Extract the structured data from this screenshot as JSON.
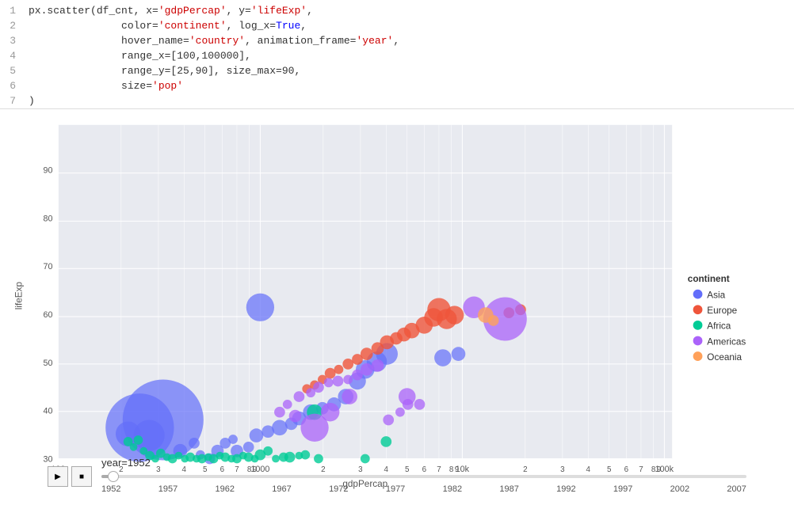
{
  "code": {
    "lines": [
      {
        "num": 1,
        "content": [
          {
            "text": "px.scatter(df_cnt, x=",
            "type": "normal"
          },
          {
            "text": "'gdpPercap'",
            "type": "str"
          },
          {
            "text": ", y=",
            "type": "normal"
          },
          {
            "text": "'lifeExp'",
            "type": "str"
          },
          {
            "text": ",",
            "type": "normal"
          }
        ]
      },
      {
        "num": 2,
        "content": [
          {
            "text": "               color=",
            "type": "normal"
          },
          {
            "text": "'continent'",
            "type": "str"
          },
          {
            "text": ", log_x=",
            "type": "normal"
          },
          {
            "text": "True",
            "type": "kw"
          },
          {
            "text": ",",
            "type": "normal"
          }
        ]
      },
      {
        "num": 3,
        "content": [
          {
            "text": "               hover_name=",
            "type": "normal"
          },
          {
            "text": "'country'",
            "type": "str"
          },
          {
            "text": ", animation_frame=",
            "type": "normal"
          },
          {
            "text": "'year'",
            "type": "str"
          },
          {
            "text": ",",
            "type": "normal"
          }
        ]
      },
      {
        "num": 4,
        "content": [
          {
            "text": "               range_x=[100,100000],",
            "type": "normal"
          }
        ]
      },
      {
        "num": 5,
        "content": [
          {
            "text": "               range_y=[25,90], size_max=90,",
            "type": "normal"
          }
        ]
      },
      {
        "num": 6,
        "content": [
          {
            "text": "               size=",
            "type": "normal"
          },
          {
            "text": "'pop'",
            "type": "str"
          },
          {
            "text": "",
            "type": "normal"
          }
        ]
      },
      {
        "num": 7,
        "content": [
          {
            "text": ")",
            "type": "normal"
          }
        ]
      }
    ]
  },
  "chart": {
    "title": "",
    "xAxis": "gdpPercap",
    "yAxis": "lifeExp",
    "yAxisLabel": "lifeExp",
    "xLabel": "gdpPercap",
    "yMin": 25,
    "yMax": 90,
    "legend": {
      "title": "continent",
      "items": [
        {
          "label": "Asia",
          "color": "#636EFA"
        },
        {
          "label": "Europe",
          "color": "#EF553B"
        },
        {
          "label": "Africa",
          "color": "#00CC96"
        },
        {
          "label": "Americas",
          "color": "#AB63FA"
        },
        {
          "label": "Oceania",
          "color": "#FFA15A"
        }
      ]
    },
    "yTicks": [
      30,
      40,
      50,
      60,
      70,
      80,
      90
    ],
    "xTickGroups": [
      {
        "label": "100",
        "ticks": []
      },
      {
        "label": "",
        "subTicks": [
          "2",
          "3",
          "4",
          "5",
          "6",
          "7",
          "8",
          "9"
        ]
      },
      {
        "label": "1000",
        "ticks": []
      },
      {
        "label": "",
        "subTicks": [
          "2",
          "3",
          "4",
          "5",
          "6",
          "7",
          "8",
          "9"
        ]
      },
      {
        "label": "10k",
        "ticks": []
      },
      {
        "label": "",
        "subTicks": [
          "2",
          "3",
          "4",
          "5",
          "6",
          "7",
          "8",
          "9"
        ]
      },
      {
        "label": "100k",
        "ticks": []
      }
    ]
  },
  "controls": {
    "yearLabel": "year=1952",
    "playButton": "▶",
    "stopButton": "■",
    "sliderMin": "1952",
    "currentYear": "1952",
    "yearTicks": [
      "1952",
      "1957",
      "1962",
      "1967",
      "1972",
      "1977",
      "1982",
      "1987",
      "1992",
      "1997",
      "2002",
      "2007"
    ]
  }
}
